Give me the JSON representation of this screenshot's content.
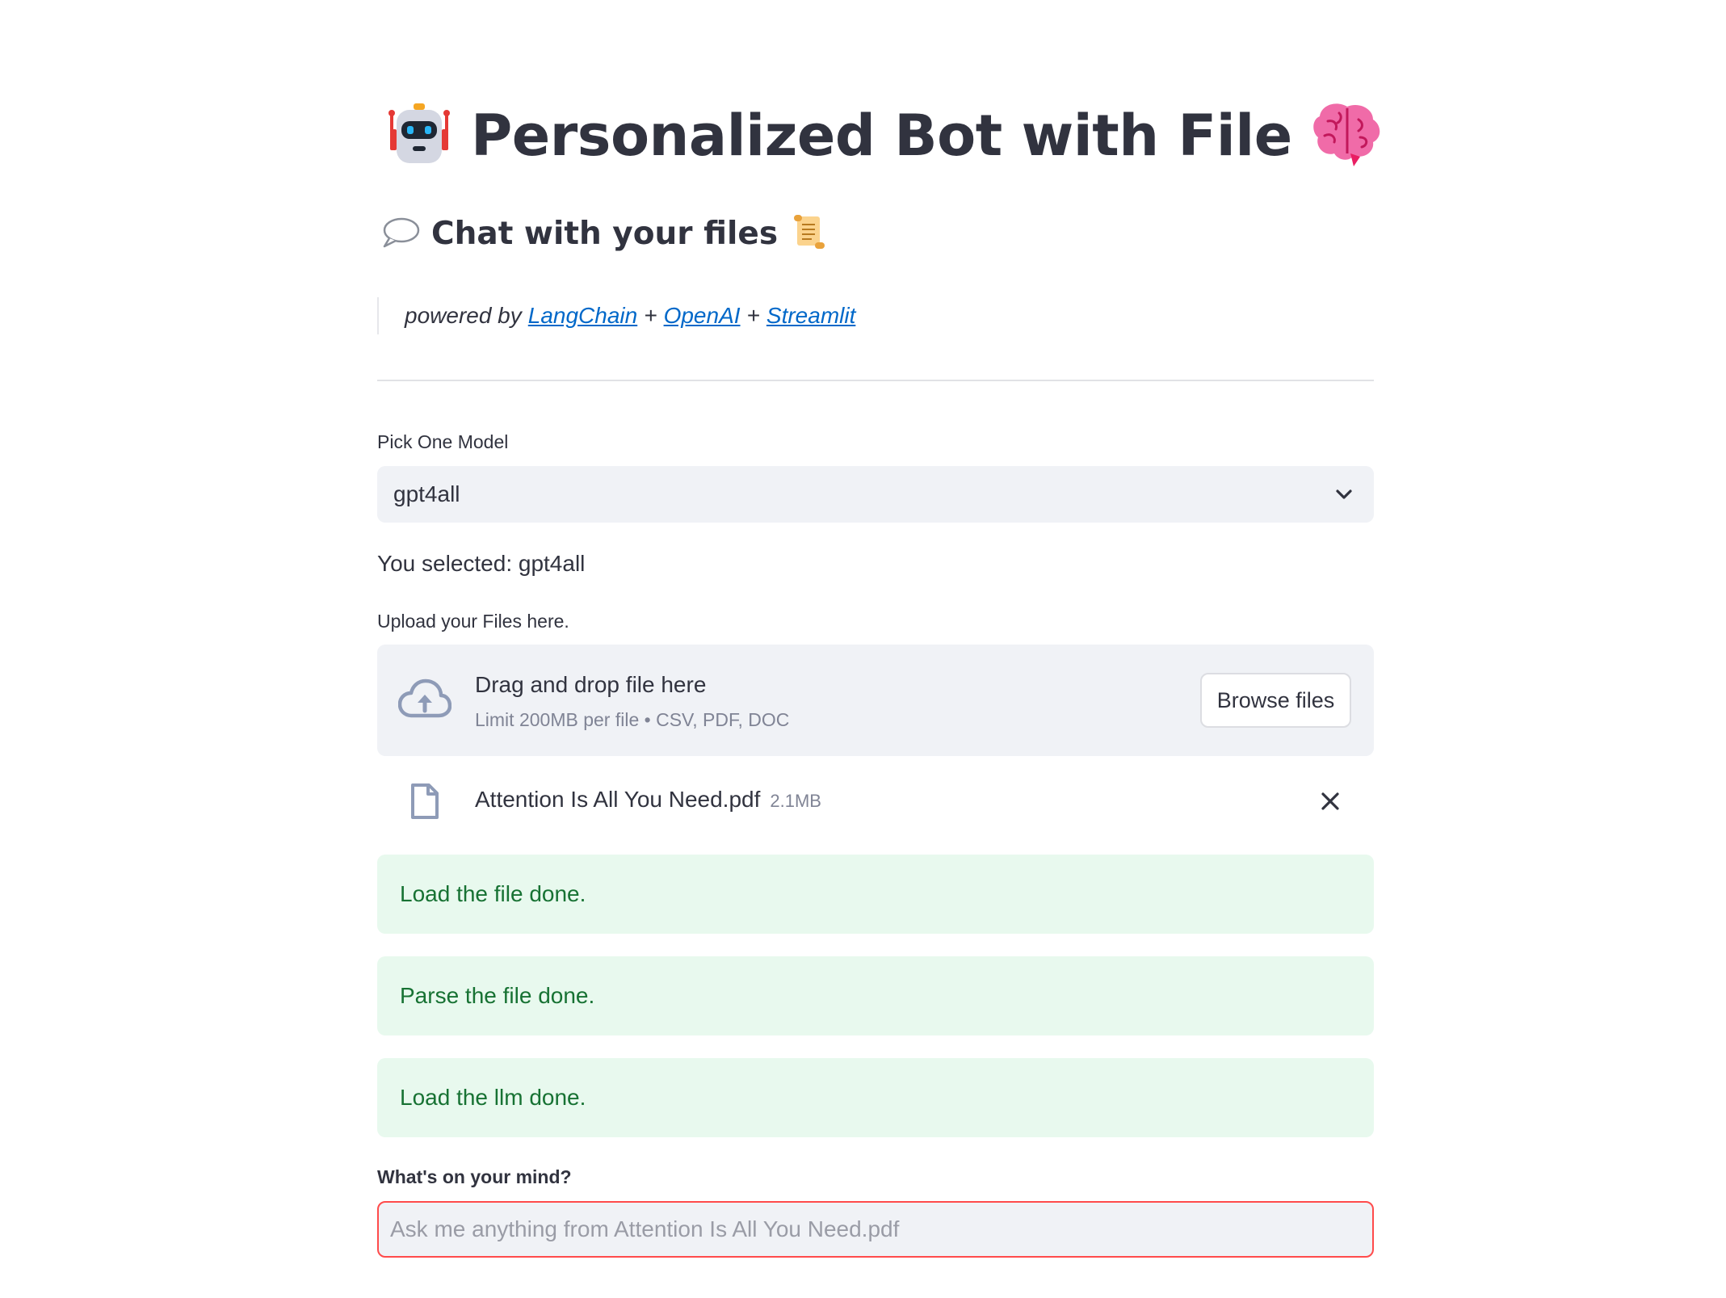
{
  "header": {
    "title": "Personalized Bot with File",
    "title_icon_left": "robot-icon",
    "title_icon_right": "brain-icon",
    "subheader": "Chat with your files",
    "subheader_icon_left": "speech-bubble-icon",
    "subheader_icon_right": "scroll-icon"
  },
  "credits": {
    "prefix": "powered by",
    "links": [
      "LangChain",
      "OpenAI",
      "Streamlit"
    ],
    "separator": "+",
    "link_color": "#0068c9"
  },
  "model_select": {
    "label": "Pick One Model",
    "value": "gpt4all"
  },
  "selection_text": "You selected: gpt4all",
  "uploader": {
    "label": "Upload your Files here.",
    "drop_title": "Drag and drop file here",
    "drop_subtitle": "Limit 200MB per file • CSV, PDF, DOC",
    "browse_label": "Browse files",
    "icon": "cloud-upload-icon"
  },
  "uploaded_file": {
    "name": "Attention Is All You Need.pdf",
    "size": "2.1MB",
    "icon": "file-icon",
    "remove_icon": "close-icon"
  },
  "alerts": [
    {
      "text": "Load the file done."
    },
    {
      "text": "Parse the file done."
    },
    {
      "text": "Load the llm done."
    }
  ],
  "question": {
    "label": "What's on your mind?",
    "placeholder": "Ask me anything from Attention Is All You Need.pdf",
    "value": ""
  },
  "colors": {
    "accent_error": "#ff4b4b",
    "success_bg": "#e8f9ee",
    "success_text": "#177233",
    "widget_bg": "#f0f2f6"
  }
}
